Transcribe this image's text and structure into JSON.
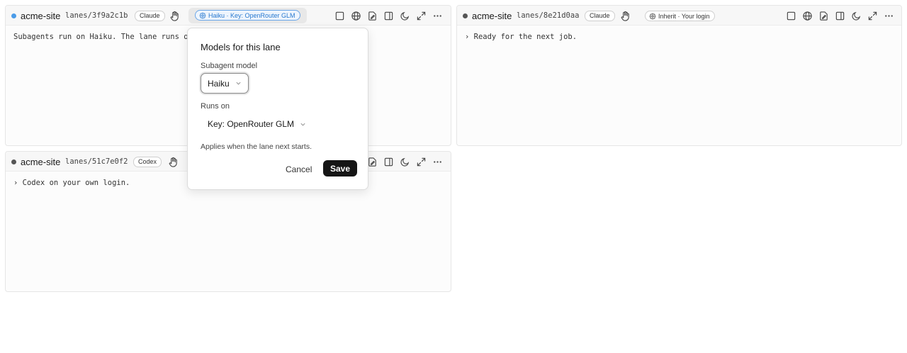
{
  "panes": [
    {
      "site": "acme-site",
      "lane": "lanes/3f9a2c1b",
      "agent": "Claude",
      "model_chip": "Haiku · Key: OpenRouter GLM",
      "body": "Subagents run on Haiku. The lane runs o",
      "status_color": "#4a9be8"
    },
    {
      "site": "acme-site",
      "lane": "lanes/8e21d0aa",
      "agent": "Claude",
      "model_chip": "Inherit · Your login",
      "body": "› Ready for the next job.",
      "status_color": "#555555"
    },
    {
      "site": "acme-site",
      "lane": "lanes/51c7e0f2",
      "agent": "Codex",
      "body": "› Codex on your own login.",
      "status_color": "#555555"
    }
  ],
  "toolbar_icons": [
    "panel-square-icon",
    "globe-icon",
    "file-edit-icon",
    "split-view-icon",
    "moon-icon",
    "expand-icon",
    "more-icon"
  ],
  "popover": {
    "title": "Models for this lane",
    "subagent_label": "Subagent model",
    "subagent_value": "Haiku",
    "runs_on_label": "Runs on",
    "runs_on_value": "Key: OpenRouter GLM",
    "note": "Applies when the lane next starts.",
    "cancel": "Cancel",
    "save": "Save"
  },
  "colors": {
    "accent": "#2a7ad0",
    "save_button": "#151515"
  }
}
